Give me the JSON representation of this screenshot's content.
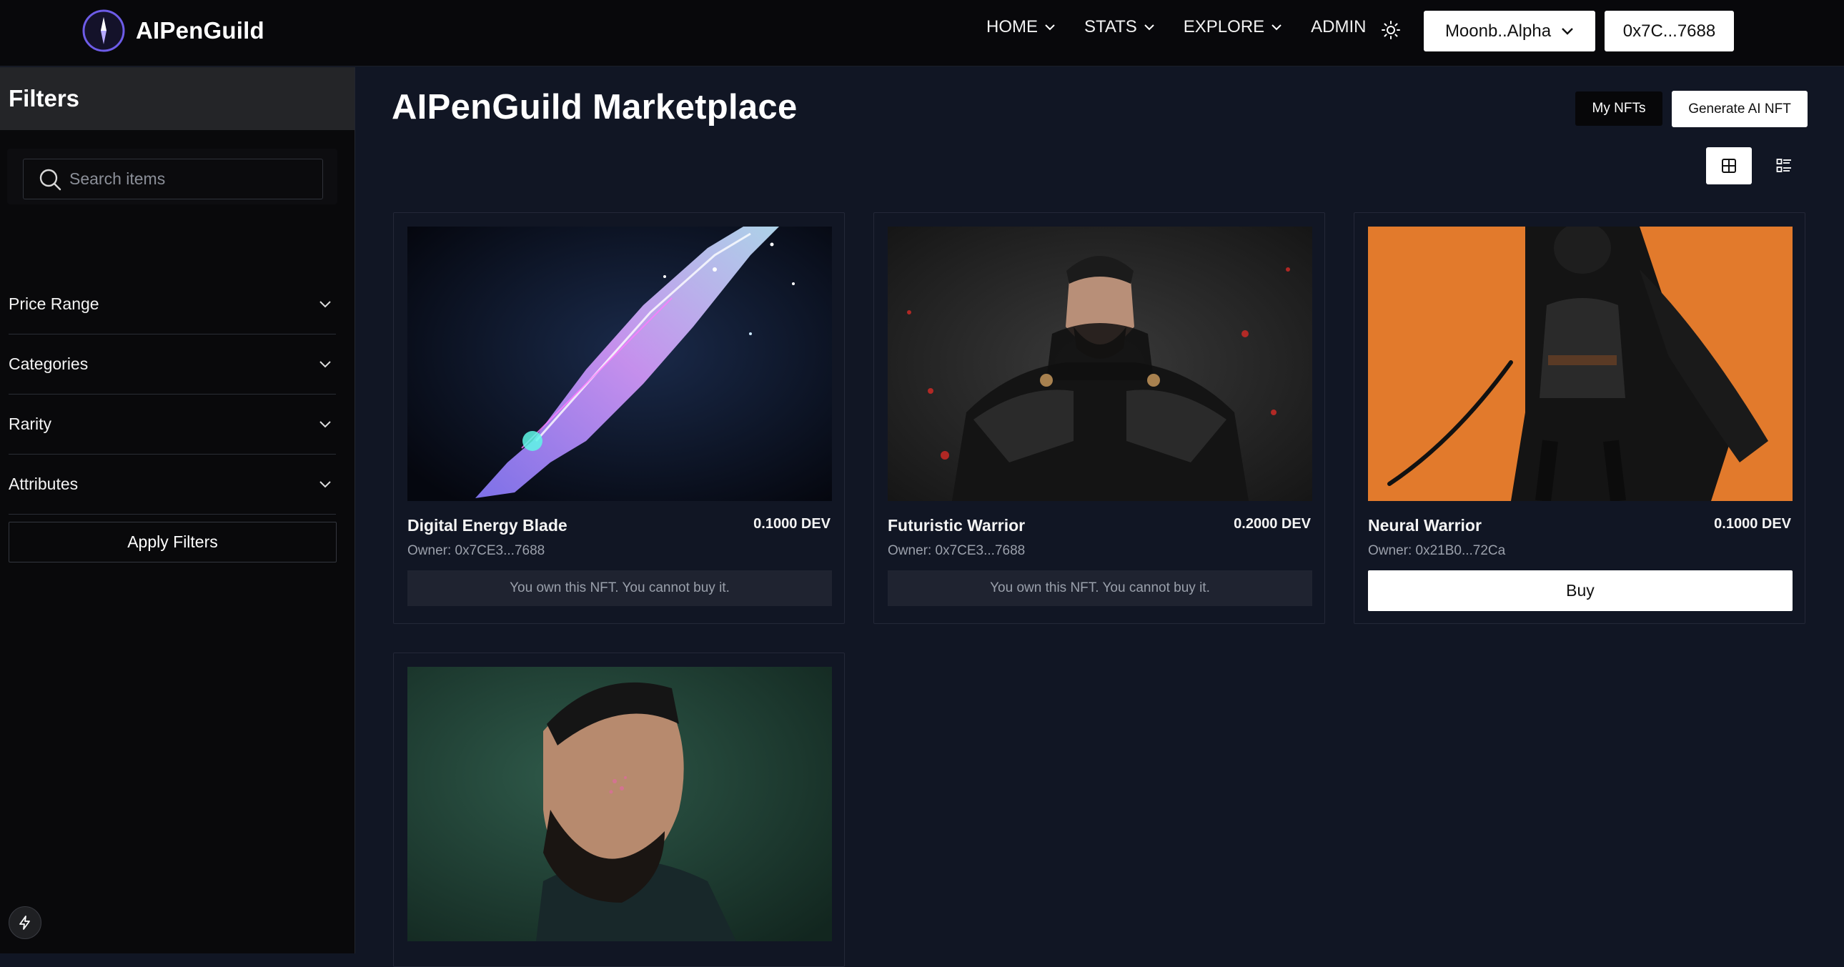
{
  "nav": {
    "brand": "AIPenGuild",
    "links": [
      {
        "label": "HOME",
        "has_dropdown": true
      },
      {
        "label": "STATS",
        "has_dropdown": true
      },
      {
        "label": "EXPLORE",
        "has_dropdown": true
      },
      {
        "label": "ADMIN",
        "has_dropdown": false
      }
    ],
    "network": "Moonb..Alpha",
    "wallet": "0x7C...7688"
  },
  "sidebar": {
    "title": "Filters",
    "search_placeholder": "Search items",
    "sections": [
      "Price Range",
      "Categories",
      "Rarity",
      "Attributes"
    ],
    "apply_label": "Apply Filters"
  },
  "main": {
    "title": "AIPenGuild Marketplace",
    "my_nfts_label": "My NFTs",
    "generate_label": "Generate AI NFT",
    "view_mode": "grid"
  },
  "cards": [
    {
      "name": "Digital Energy Blade",
      "price": "0.1000 DEV",
      "owner": "Owner: 0x7CE3...7688",
      "status": "You own this NFT. You cannot buy it.",
      "image": "glowing crystal energy sword"
    },
    {
      "name": "Futuristic Warrior",
      "price": "0.2000 DEV",
      "owner": "Owner: 0x7CE3...7688",
      "status": "You own this NFT. You cannot buy it.",
      "image": "armored warrior on red-black background"
    },
    {
      "name": "Neural Warrior",
      "price": "0.1000 DEV",
      "owner": "Owner: 0x21B0...72Ca",
      "buy_label": "Buy",
      "image": "dark caped samurai on orange background"
    },
    {
      "image": "bearded man portrait on green background"
    }
  ],
  "colors": {
    "background": "#111624",
    "nav_background": "#08080b",
    "sidebar_background": "#09090b",
    "accent_logo": "#6d5ce8"
  }
}
